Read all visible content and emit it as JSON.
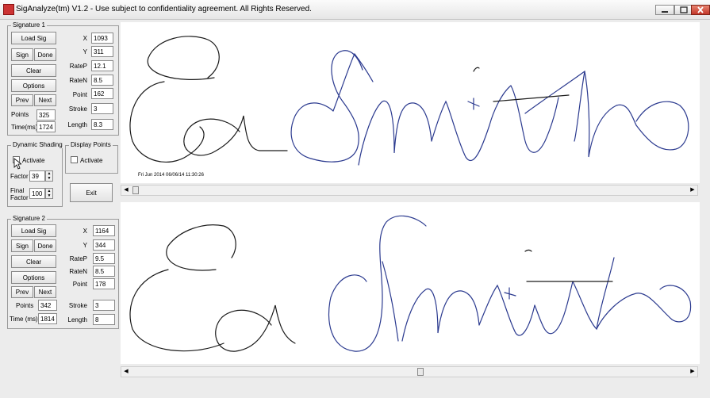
{
  "window": {
    "title": "SigAnalyze(tm) V1.2 - Use subject to confidentiality agreement. All Rights Reserved."
  },
  "signature1": {
    "group_title": "Signature 1",
    "load_sig": "Load Sig",
    "sign": "Sign",
    "done": "Done",
    "clear": "Clear",
    "options": "Options",
    "prev": "Prev",
    "next": "Next",
    "points_label": "Points",
    "points": "325",
    "time_label": "Time(ms)",
    "time": "1724",
    "x_label": "X",
    "x": "1093",
    "y_label": "Y",
    "y": "311",
    "ratep_label": "RateP",
    "ratep": "12.1",
    "raten_label": "RateN",
    "raten": "8.5",
    "point_label": "Point",
    "point": "162",
    "stroke_label": "Stroke",
    "stroke": "3",
    "length_label": "Length",
    "length": "8.3"
  },
  "dynamic_shading": {
    "group_title": "Dynamic Shading",
    "activate": "Activate",
    "factor_label": "Factor",
    "factor": "39",
    "final_factor_label1": "Final",
    "final_factor_label2": "Factor",
    "final_factor": "100"
  },
  "display_points": {
    "group_title": "Display Points",
    "activate": "Activate"
  },
  "exit": "Exit",
  "signature2": {
    "group_title": "Signature 2",
    "load_sig": "Load Sig",
    "sign": "Sign",
    "done": "Done",
    "clear": "Clear",
    "options": "Options",
    "prev": "Prev",
    "next": "Next",
    "points_label": "Points",
    "points": "342",
    "time_label": "Time (ms)",
    "time": "1814",
    "x_label": "X",
    "x": "1164",
    "y_label": "Y",
    "y": "344",
    "ratep_label": "RateP",
    "ratep": "9.5",
    "raten_label": "RateN",
    "raten": "8.5",
    "point_label": "Point",
    "point": "178",
    "stroke_label": "Stroke",
    "stroke": "3",
    "length_label": "Length",
    "length": "8"
  },
  "canvas1": {
    "timestamp": "Fri Jun 2014 06/06/14 11:30:26"
  },
  "colors": {
    "ink_black": "#1a1a1a",
    "ink_blue": "#2b3a8f"
  }
}
